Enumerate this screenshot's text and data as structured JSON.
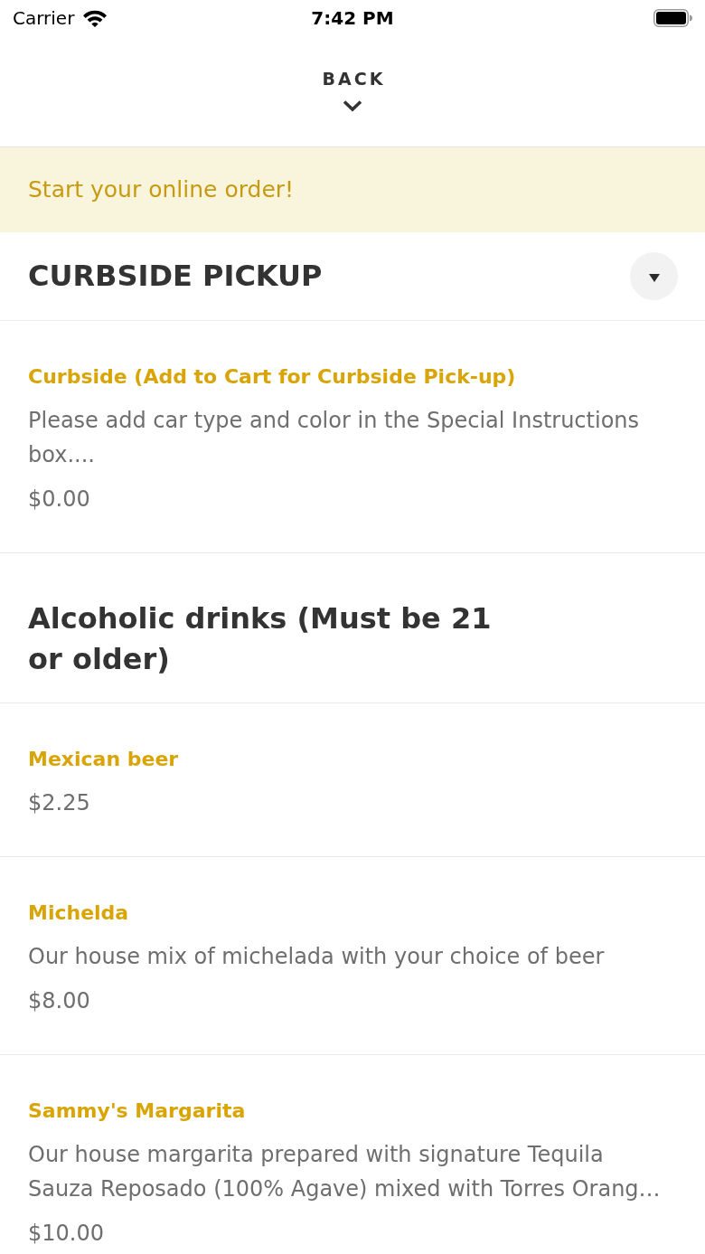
{
  "status_bar": {
    "carrier": "Carrier",
    "time": "7:42 PM"
  },
  "nav": {
    "back": "BACK"
  },
  "banner": {
    "text": "Start your online order!"
  },
  "sections": [
    {
      "title": "CURBSIDE PICKUP",
      "collapsible": true,
      "items": [
        {
          "name": "Curbside (Add to Cart for Curbside Pick-up)",
          "description": "Please add car type and color in the Special Instructions box....",
          "price": "$0.00"
        }
      ]
    },
    {
      "title": "Alcoholic drinks (Must be 21 or older)",
      "collapsible": false,
      "items": [
        {
          "name": "Mexican beer",
          "price": "$2.25"
        },
        {
          "name": "Michelda",
          "description": "Our house mix of michelada with your choice of beer",
          "price": "$8.00"
        },
        {
          "name": "Sammy's Margarita",
          "description": "Our house margarita prepared with signature Tequila Sauza Reposado (100% Agave) mixed with Torres Orang…",
          "price": "$10.00"
        }
      ]
    }
  ]
}
